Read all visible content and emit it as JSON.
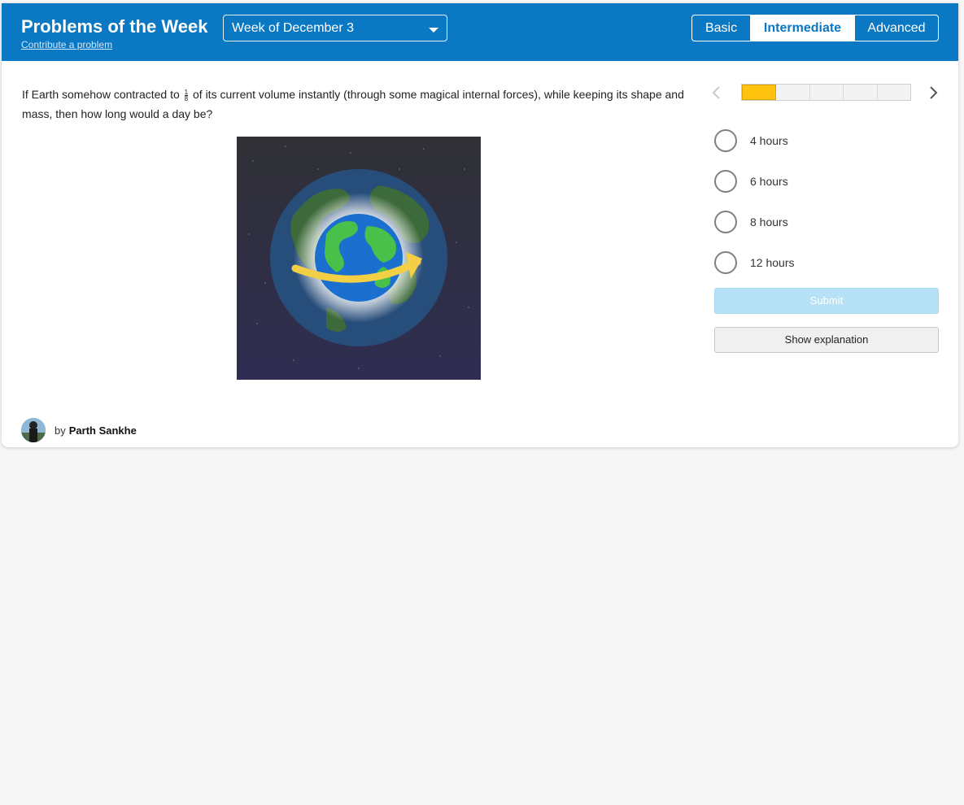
{
  "header": {
    "title": "Problems of the Week",
    "contribute_link": "Contribute a problem",
    "week_select": {
      "selected": "Week of December 3"
    },
    "levels": [
      {
        "label": "Basic",
        "active": false
      },
      {
        "label": "Intermediate",
        "active": true
      },
      {
        "label": "Advanced",
        "active": false
      }
    ]
  },
  "problem": {
    "question_before": "If Earth somehow contracted to",
    "fraction": {
      "numerator": "1",
      "denominator": "8"
    },
    "question_after": "of its current volume instantly (through some magical internal forces), while keeping its shape and mass, then how long would a day be?",
    "image_icon": "earth-contracting-icon",
    "author_prefix": "by",
    "author_name": "Parth Sankhe"
  },
  "progress": {
    "segments": 5,
    "current": 1
  },
  "options": [
    {
      "label": "4 hours"
    },
    {
      "label": "6 hours"
    },
    {
      "label": "8 hours"
    },
    {
      "label": "12 hours"
    }
  ],
  "actions": {
    "submit_label": "Submit",
    "explanation_label": "Show explanation"
  },
  "colors": {
    "header_bg": "#0a78c2",
    "progress_active": "#ffc20e",
    "submit_disabled": "#b7e1f6"
  }
}
